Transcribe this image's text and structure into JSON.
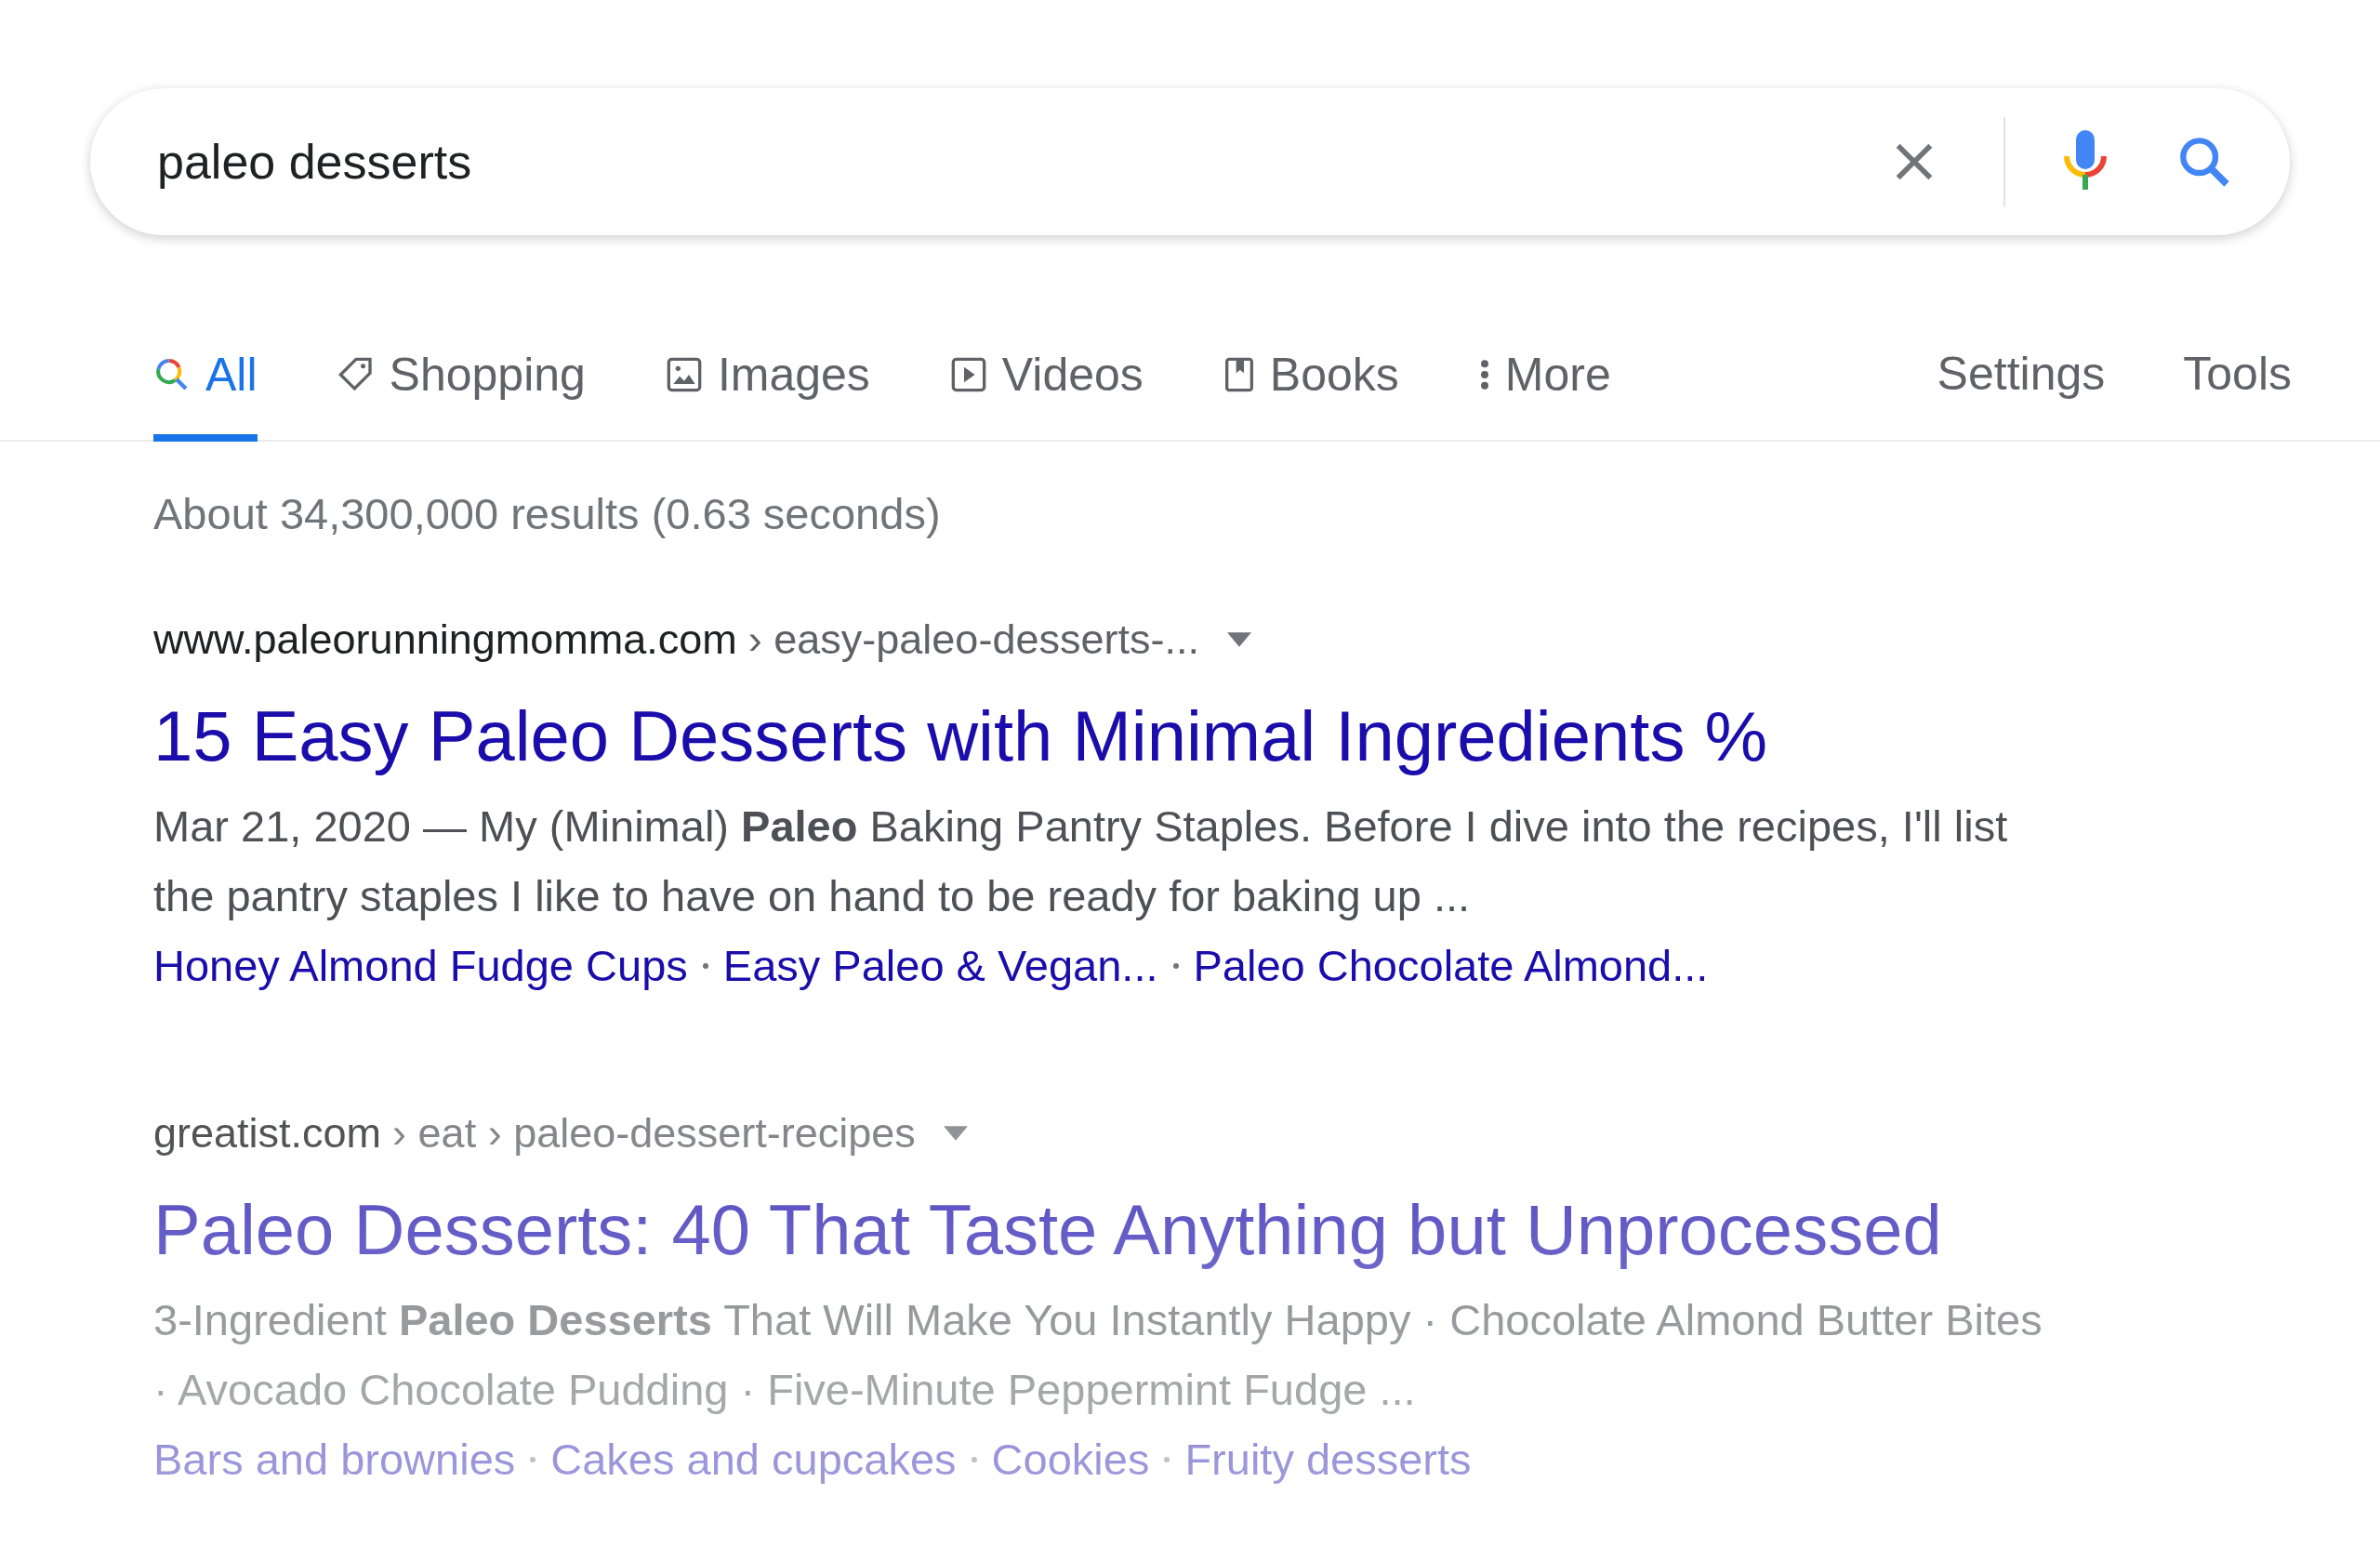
{
  "search": {
    "value": "paleo desserts"
  },
  "tabs": [
    {
      "label": "All",
      "kind": "all",
      "selected": true
    },
    {
      "label": "Shopping",
      "kind": "shopping",
      "selected": false
    },
    {
      "label": "Images",
      "kind": "images",
      "selected": false
    },
    {
      "label": "Videos",
      "kind": "videos",
      "selected": false
    },
    {
      "label": "Books",
      "kind": "books",
      "selected": false
    },
    {
      "label": "More",
      "kind": "more",
      "selected": false
    }
  ],
  "tools": [
    "Settings",
    "Tools"
  ],
  "result_stats": "About 34,300,000 results (0.63 seconds)",
  "results": [
    {
      "faded": false,
      "site": "www.paleorunningmomma.com",
      "path": "› easy-paleo-desserts-...",
      "title": "15 Easy Paleo Desserts with Minimal Ingredients %",
      "snippet_lines": [
        "Mar 21, 2020 — My (Minimal) **Paleo** Baking Pantry Staples. Before I dive into the recipes, I'll list",
        "the pantry staples I like to have on hand to be ready for baking up ..."
      ],
      "sitelinks": [
        "Honey Almond Fudge Cups",
        "Easy Paleo & Vegan...",
        "Paleo Chocolate Almond..."
      ]
    },
    {
      "faded": true,
      "site": "greatist.com",
      "path": "› eat › paleo-dessert-recipes",
      "title": "Paleo Desserts: 40 That Taste Anything but Unprocessed",
      "snippet_lines": [
        "3-Ingredient **Paleo Desserts** That Will Make You Instantly Happy · Chocolate Almond Butter Bites",
        "· Avocado Chocolate Pudding · Five-Minute Peppermint Fudge ..."
      ],
      "sitelinks": [
        "Bars and brownies",
        "Cakes and cupcakes",
        "Cookies",
        "Fruity desserts"
      ]
    }
  ]
}
